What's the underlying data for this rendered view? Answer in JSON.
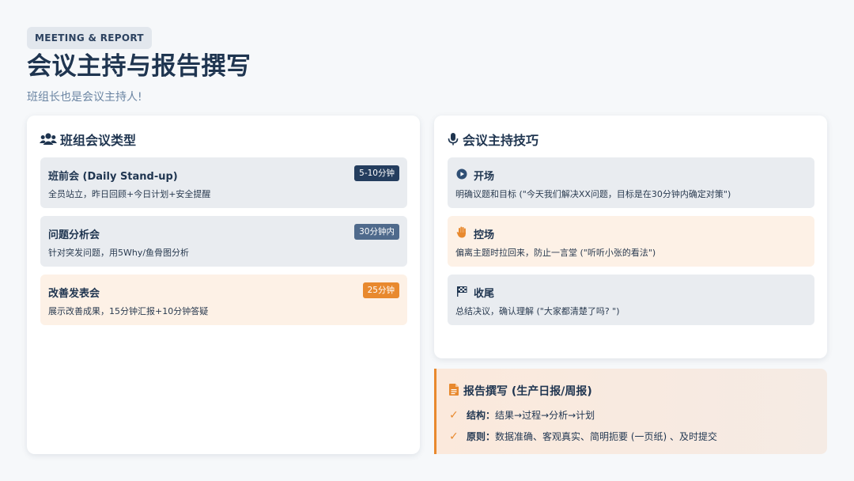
{
  "header": {
    "tag": "MEETING & REPORT",
    "title": "会议主持与报告撰写",
    "subtitle": "班组长也是会议主持人!"
  },
  "meeting_types": {
    "heading": "班组会议类型",
    "icon": "users-icon",
    "items": [
      {
        "title": "班前会 (Daily Stand-up)",
        "desc": "全员站立，昨日回顾+今日计划+安全提醒",
        "badge": "5-10分钟",
        "badge_color": "#243d5e"
      },
      {
        "title": "问题分析会",
        "desc": "针对突发问题，用5Why/鱼骨图分析",
        "badge": "30分钟内",
        "badge_color": "#4f6a8c"
      },
      {
        "title": "改善发表会",
        "desc": "展示改善成果，15分钟汇报+10分钟答疑",
        "badge": "25分钟",
        "badge_color": "#e8892e"
      }
    ]
  },
  "hosting_skills": {
    "heading": "会议主持技巧",
    "icon": "microphone-icon",
    "items": [
      {
        "icon": "play-circle-icon",
        "title": "开场",
        "desc": "明确议题和目标 (\"今天我们解决XX问题，目标是在30分钟内确定对策\")"
      },
      {
        "icon": "hand-icon",
        "title": "控场",
        "desc": "偏离主题时拉回来，防止一言堂 (\"听听小张的看法\")"
      },
      {
        "icon": "checkered-flag-icon",
        "title": "收尾",
        "desc": "总结决议，确认理解 (\"大家都清楚了吗? \")"
      }
    ]
  },
  "report": {
    "heading": "报告撰写 (生产日报/周报)",
    "icon": "document-icon",
    "lines": [
      {
        "label": "结构：",
        "text": "结果→过程→分析→计划"
      },
      {
        "label": "原则：",
        "text": "数据准确、客观真实、简明扼要 (一页纸) 、及时提交"
      }
    ]
  },
  "colors": {
    "navy": "#1f3550",
    "accent_orange": "#e8892e",
    "item_gray": "#e9ecf0",
    "item_orange": "#fdf1e6"
  }
}
